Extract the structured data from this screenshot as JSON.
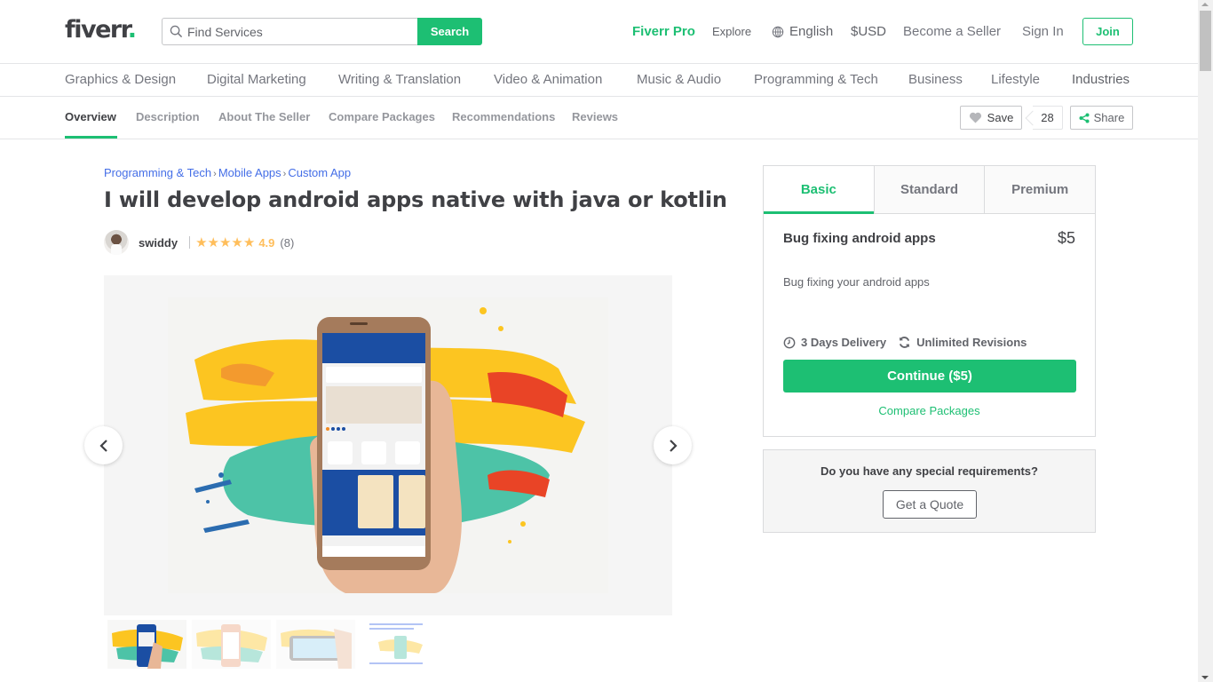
{
  "header": {
    "logo_text": "fiverr",
    "logo_dot": ".",
    "search_placeholder": "Find Services",
    "search_button": "Search",
    "nav": {
      "fiverr_pro": "Fiverr Pro",
      "explore": "Explore",
      "language": "English",
      "currency": "$USD",
      "become_seller": "Become a Seller",
      "sign_in": "Sign In",
      "join": "Join"
    }
  },
  "categories": [
    "Graphics & Design",
    "Digital Marketing",
    "Writing & Translation",
    "Video & Animation",
    "Music & Audio",
    "Programming & Tech",
    "Business",
    "Lifestyle",
    "Industries"
  ],
  "subnav": {
    "tabs": [
      "Overview",
      "Description",
      "About The Seller",
      "Compare Packages",
      "Recommendations",
      "Reviews"
    ],
    "active_tab": "Overview",
    "save_label": "Save",
    "save_count": "28",
    "share_label": "Share"
  },
  "gig": {
    "breadcrumb": [
      "Programming & Tech",
      "Mobile Apps",
      "Custom App"
    ],
    "breadcrumb_sep": "›",
    "title": "I will develop android apps native with java or kotlin",
    "seller_name": "swiddy",
    "stars": "★★★★★",
    "rating": "4.9",
    "review_count": "(8)",
    "gallery": {
      "thumbnail_count": 4,
      "active_thumbnail": 1
    }
  },
  "package": {
    "tabs": [
      "Basic",
      "Standard",
      "Premium"
    ],
    "active_tab": "Basic",
    "name": "Bug fixing android apps",
    "price": "$5",
    "description": "Bug fixing your android apps",
    "delivery": "3 Days Delivery",
    "revisions": "Unlimited Revisions",
    "continue_button": "Continue ($5)",
    "compare_link": "Compare Packages"
  },
  "quote": {
    "question": "Do you have any special requirements?",
    "button": "Get a Quote"
  },
  "colors": {
    "brand_green": "#1dbf73",
    "link_blue": "#446ee7",
    "star_yellow": "#ffbe5b",
    "text_dark": "#404145"
  }
}
